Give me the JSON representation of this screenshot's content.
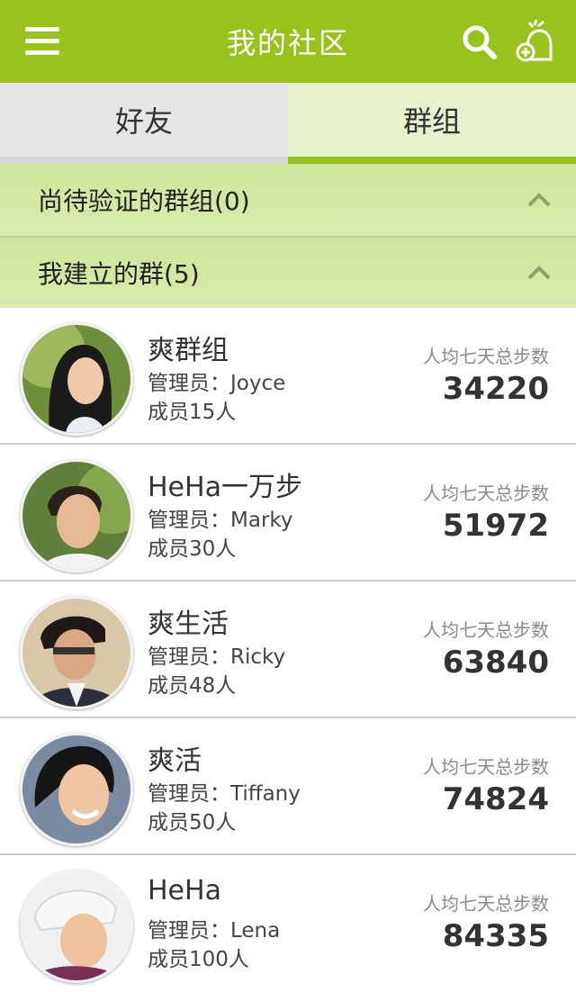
{
  "header": {
    "title": "我的社区",
    "icons": [
      "menu-icon",
      "search-icon",
      "add-group-icon"
    ],
    "accent": "#99c31c"
  },
  "tabs": [
    {
      "label": "好友",
      "active": false
    },
    {
      "label": "群组",
      "active": true
    }
  ],
  "sections": [
    {
      "label": "尚待验证的群组(0)",
      "expanded": true
    },
    {
      "label": "我建立的群(5)",
      "expanded": true
    }
  ],
  "groups": [
    {
      "name": "爽群组",
      "admin": "管理员：Joyce",
      "members": "成员15人",
      "metric_label": "人均七天总步数",
      "steps": "34220"
    },
    {
      "name": "HeHa一万步",
      "admin": "管理员：Marky",
      "members": "成员30人",
      "metric_label": "人均七天总步数",
      "steps": "51972"
    },
    {
      "name": "爽生活",
      "admin": "管理员：Ricky",
      "members": "成员48人",
      "metric_label": "人均七天总步数",
      "steps": "63840"
    },
    {
      "name": "爽活",
      "admin": "管理员：Tiffany",
      "members": "成员50人",
      "metric_label": "人均七天总步数",
      "steps": "74824"
    },
    {
      "name": "HeHa",
      "admin": "管理员：Lena",
      "members": "成员100人",
      "metric_label": "人均七天总步数",
      "steps": "84335"
    }
  ]
}
